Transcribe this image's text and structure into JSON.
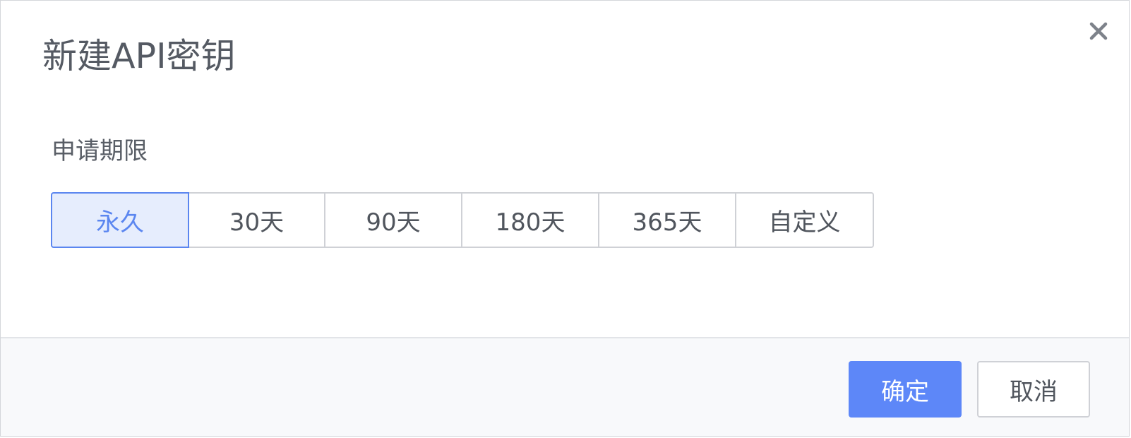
{
  "dialog": {
    "title": "新建API密钥",
    "close_icon": "close-icon"
  },
  "form": {
    "duration_label": "申请期限",
    "options": [
      {
        "label": "永久",
        "selected": true
      },
      {
        "label": "30天",
        "selected": false
      },
      {
        "label": "90天",
        "selected": false
      },
      {
        "label": "180天",
        "selected": false
      },
      {
        "label": "365天",
        "selected": false
      },
      {
        "label": "自定义",
        "selected": false
      }
    ]
  },
  "footer": {
    "confirm_label": "确定",
    "cancel_label": "取消"
  },
  "colors": {
    "accent": "#5d87f8",
    "selected_bg": "#e6edfd"
  }
}
